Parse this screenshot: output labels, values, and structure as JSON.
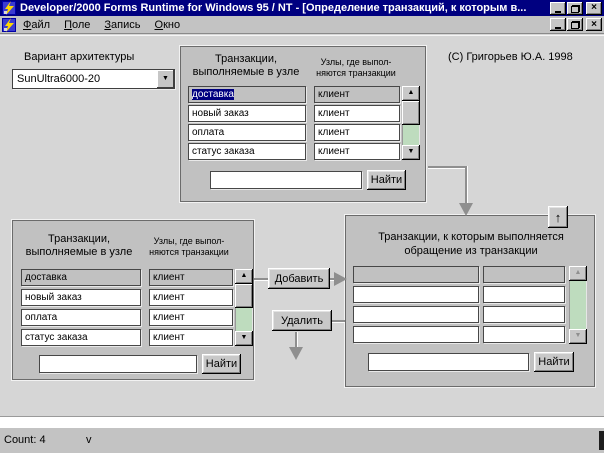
{
  "window": {
    "title": "Developer/2000 Forms Runtime for Windows 95 / NT - [Определение транзакций, к которым в...",
    "menu": {
      "file": "Файл",
      "field": "Поле",
      "record": "Запись",
      "window": "Окно"
    }
  },
  "canvas": {
    "copyright": "(С) Григорьев Ю.А. 1998",
    "architecture": {
      "label": "Вариант архитектуры",
      "value": "SunUltra6000-20"
    }
  },
  "panel_top": {
    "header_transactions_line1": "Транзакции,",
    "header_transactions_line2": "выполняемые в узле",
    "header_nodes_line1": "Узлы, где выпол-",
    "header_nodes_line2": "няются транзакции",
    "rows": [
      {
        "transaction": "доставка",
        "node": "клиент"
      },
      {
        "transaction": "новый заказ",
        "node": "клиент"
      },
      {
        "transaction": "оплата",
        "node": "клиент"
      },
      {
        "transaction": "статус заказа",
        "node": "клиент"
      }
    ],
    "search_value": "",
    "find_button": "Найти"
  },
  "panel_left": {
    "header_transactions_line1": "Транзакции,",
    "header_transactions_line2": "выполняемые в узле",
    "header_nodes_line1": "Узлы, где выпол-",
    "header_nodes_line2": "няются транзакции",
    "rows": [
      {
        "transaction": "доставка",
        "node": "клиент"
      },
      {
        "transaction": "новый заказ",
        "node": "клиент"
      },
      {
        "transaction": "оплата",
        "node": "клиент"
      },
      {
        "transaction": "статус заказа",
        "node": "клиент"
      }
    ],
    "search_value": "",
    "find_button": "Найти"
  },
  "panel_right": {
    "header_line1": "Транзакции, к которым выполняется",
    "header_line2": "обращение из транзакции",
    "search_value": "",
    "find_button": "Найти"
  },
  "actions": {
    "add": "Добавить",
    "remove": "Удалить"
  },
  "icons": {
    "scroll_up": "▲",
    "scroll_down": "▼",
    "dropdown": "▼",
    "up_arrow": "↑",
    "close": "×"
  },
  "status": {
    "count": "Count: 4",
    "marker": "v"
  },
  "colors": {
    "titlebar": "#000080",
    "selection": "#000080",
    "panel_gray": "#c1c1c1",
    "canvas_gray": "#d6d6d6",
    "scroll_green": "#bedcbe"
  }
}
